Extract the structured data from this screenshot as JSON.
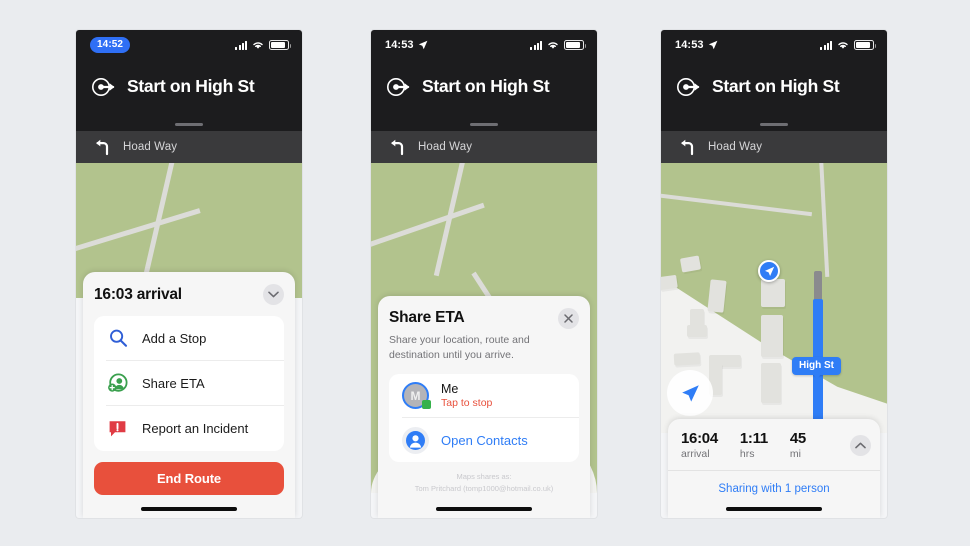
{
  "background_color": "#eaecef",
  "accent_blue": "#2f7df6",
  "danger_red": "#e8503c",
  "phones": [
    {
      "id": "phone-1",
      "status_bar": {
        "time": "14:52",
        "time_is_pill": true,
        "signal_icon": "cellular-bars-icon",
        "wifi_icon": "wifi-icon",
        "battery_icon": "battery-icon"
      },
      "nav_header": {
        "maneuver_icon": "start-route-icon",
        "title": "Start on High St",
        "grabber": "drag-handle"
      },
      "next_step": {
        "turn_icon": "turn-left-icon",
        "label": "Hoad Way"
      },
      "sheet": {
        "title": "16:03 arrival",
        "collapse_icon": "chevron-down-icon",
        "menu": [
          {
            "icon": "search-icon",
            "label": "Add a Stop"
          },
          {
            "icon": "share-eta-icon",
            "label": "Share ETA"
          },
          {
            "icon": "report-incident-icon",
            "label": "Report an Incident"
          }
        ],
        "end_route_label": "End Route"
      }
    },
    {
      "id": "phone-2",
      "status_bar": {
        "time": "14:53",
        "time_is_pill": false,
        "location_icon": "location-arrow-icon",
        "signal_icon": "cellular-bars-icon",
        "wifi_icon": "wifi-icon",
        "battery_icon": "battery-icon"
      },
      "nav_header": {
        "maneuver_icon": "start-route-icon",
        "title": "Start on High St",
        "grabber": "drag-handle"
      },
      "next_step": {
        "turn_icon": "turn-left-icon",
        "label": "Hoad Way"
      },
      "sheet": {
        "title": "Share ETA",
        "close_icon": "close-icon",
        "subtitle": "Share your location, route and destination until you arrive.",
        "rows": [
          {
            "avatar": "me-avatar",
            "avatar_initial": "M",
            "name": "Me",
            "status": "Tap to stop"
          },
          {
            "avatar": "contacts-avatar",
            "label": "Open Contacts"
          }
        ],
        "footer_line1": "Maps shares as:",
        "footer_line2": "Tom Pritchard (tomp1000@hotmail.co.uk)"
      }
    },
    {
      "id": "phone-3",
      "status_bar": {
        "time": "14:53",
        "time_is_pill": false,
        "location_icon": "location-arrow-icon",
        "signal_icon": "cellular-bars-icon",
        "wifi_icon": "wifi-icon",
        "battery_icon": "battery-icon"
      },
      "nav_header": {
        "maneuver_icon": "start-route-icon",
        "title": "Start on High St",
        "grabber": "drag-handle"
      },
      "next_step": {
        "turn_icon": "turn-left-icon",
        "label": "Hoad Way"
      },
      "map": {
        "street_label": "High St",
        "user_puck_icon": "navigation-puck-icon",
        "destination_icon": "navigation-arrow-icon"
      },
      "eta": {
        "arrival_value": "16:04",
        "arrival_label": "arrival",
        "duration_value": "1:11",
        "duration_label": "hrs",
        "distance_value": "45",
        "distance_label": "mi",
        "expand_icon": "chevron-up-icon",
        "sharing_text": "Sharing with 1 person"
      }
    }
  ]
}
